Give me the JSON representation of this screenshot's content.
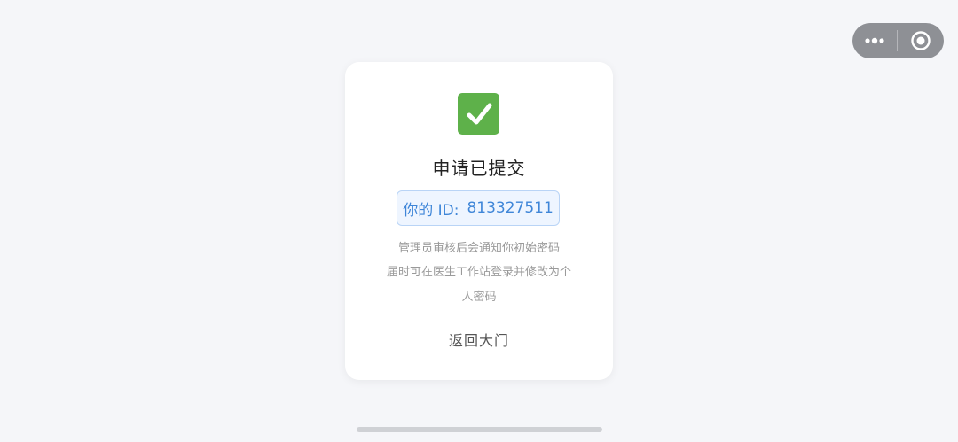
{
  "capsule": {
    "more_icon": "more-dots-icon",
    "close_icon": "close-circle-icon"
  },
  "card": {
    "icon": "check-mark-icon",
    "title": "申请已提交",
    "id_prefix": "你的 ID:",
    "id_value": "813327511",
    "note_line1": "管理员审核后会通知你初始密码",
    "note_line2": "届时可在医生工作站登录并修改为个",
    "note_line3": "人密码",
    "back_label": "返回大门"
  },
  "colors": {
    "success": "#5eb14a",
    "id_text": "#3f86d8",
    "id_border": "#b9d4f6",
    "id_background": "#eef5ff"
  }
}
